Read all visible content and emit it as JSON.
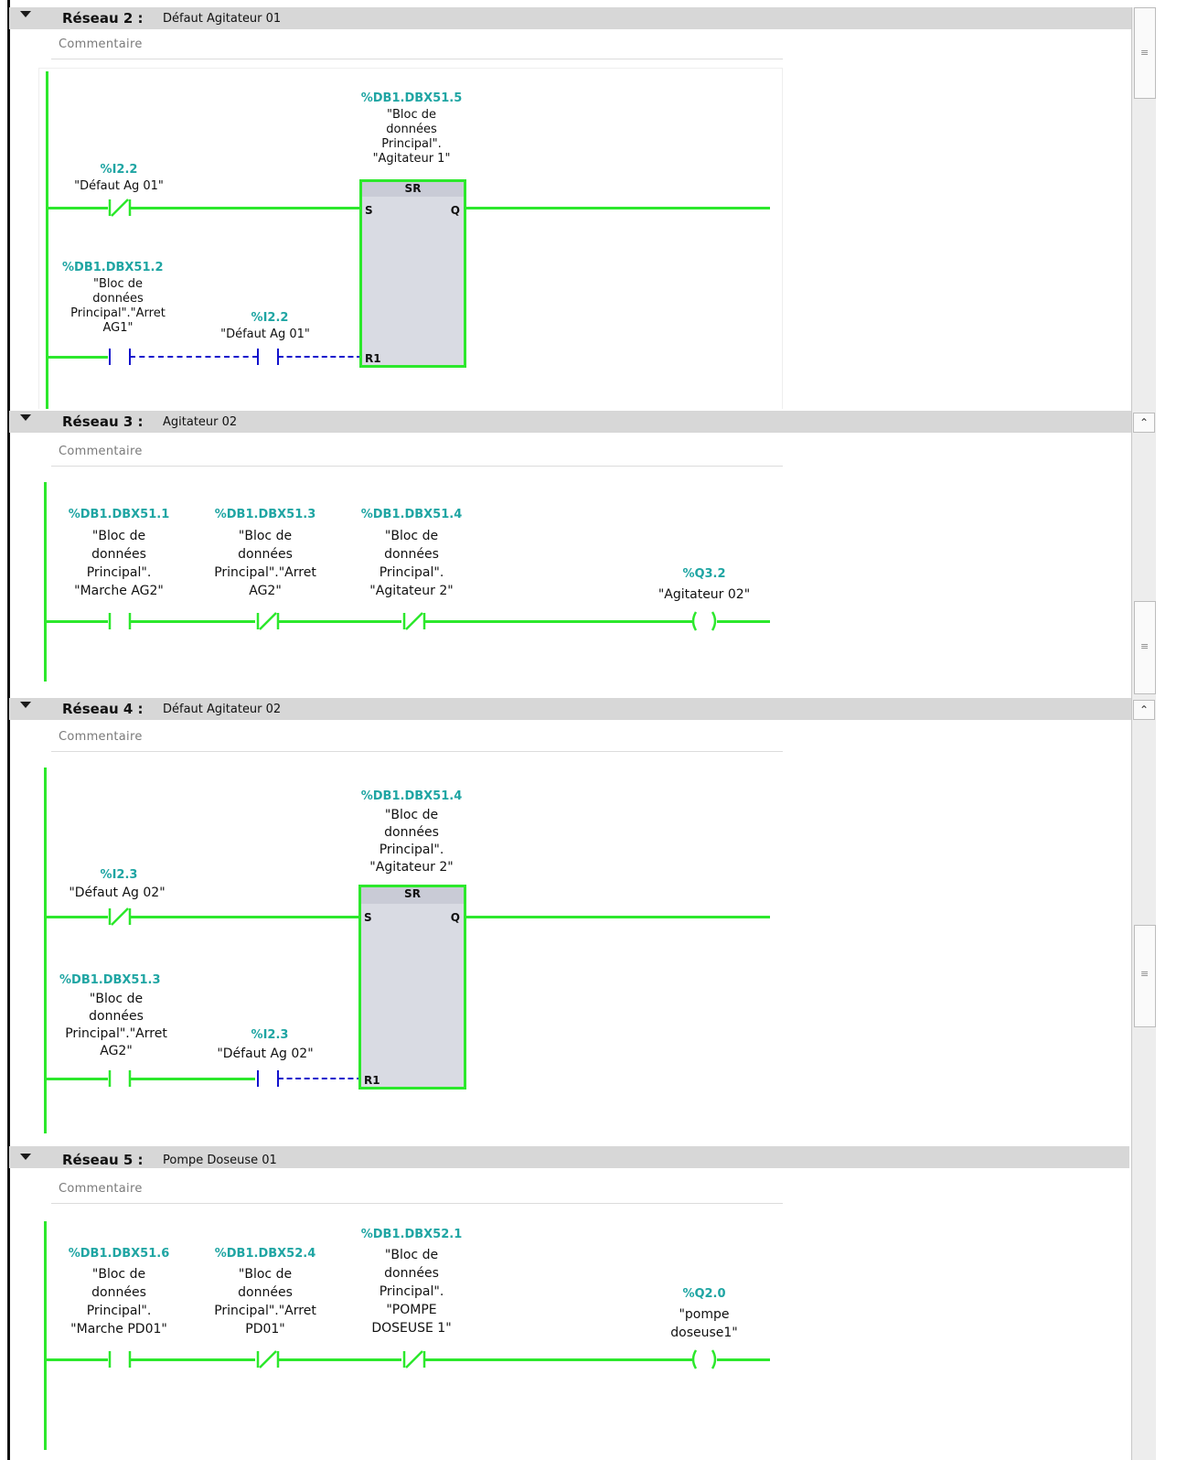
{
  "networks": [
    {
      "title": "Réseau 2 :",
      "subtitle": "Défaut Agitateur 01",
      "comment": "Commentaire",
      "sr": {
        "addr": "%DB1.DBX51.5",
        "label": "\"Bloc de\ndonnées\nPrincipal\".\n\"Agitateur 1\"",
        "title": "SR",
        "pin_s": "S",
        "pin_q": "Q",
        "pin_r": "R1"
      },
      "contacts": [
        {
          "addr": "%I2.2",
          "label": "\"Défaut Ag 01\""
        },
        {
          "addr": "%DB1.DBX51.2",
          "label": "\"Bloc de\ndonnées\nPrincipal\".\"Arret\nAG1\""
        },
        {
          "addr": "%I2.2",
          "label": "\"Défaut Ag 01\""
        }
      ]
    },
    {
      "title": "Réseau 3 :",
      "subtitle": "Agitateur 02",
      "comment": "Commentaire",
      "contacts": [
        {
          "addr": "%DB1.DBX51.1",
          "label": "\"Bloc de\ndonnées\nPrincipal\".\n\"Marche AG2\""
        },
        {
          "addr": "%DB1.DBX51.3",
          "label": "\"Bloc de\ndonnées\nPrincipal\".\"Arret\nAG2\""
        },
        {
          "addr": "%DB1.DBX51.4",
          "label": "\"Bloc de\ndonnées\nPrincipal\".\n\"Agitateur 2\""
        }
      ],
      "coil": {
        "addr": "%Q3.2",
        "label": "\"Agitateur 02\""
      }
    },
    {
      "title": "Réseau 4 :",
      "subtitle": "Défaut Agitateur 02",
      "comment": "Commentaire",
      "sr": {
        "addr": "%DB1.DBX51.4",
        "label": "\"Bloc de\ndonnées\nPrincipal\".\n\"Agitateur 2\"",
        "title": "SR",
        "pin_s": "S",
        "pin_q": "Q",
        "pin_r": "R1"
      },
      "contacts": [
        {
          "addr": "%I2.3",
          "label": "\"Défaut Ag 02\""
        },
        {
          "addr": "%DB1.DBX51.3",
          "label": "\"Bloc de\ndonnées\nPrincipal\".\"Arret\nAG2\""
        },
        {
          "addr": "%I2.3",
          "label": "\"Défaut Ag 02\""
        }
      ]
    },
    {
      "title": "Réseau 5 :",
      "subtitle": "Pompe Doseuse 01",
      "comment": "Commentaire",
      "contacts": [
        {
          "addr": "%DB1.DBX51.6",
          "label": "\"Bloc de\ndonnées\nPrincipal\".\n\"Marche PD01\""
        },
        {
          "addr": "%DB1.DBX52.4",
          "label": "\"Bloc de\ndonnées\nPrincipal\".\"Arret\nPD01\""
        },
        {
          "addr": "%DB1.DBX52.1",
          "label": "\"Bloc de\ndonnées\nPrincipal\".\n\"POMPE\nDOSEUSE 1\""
        }
      ],
      "coil": {
        "addr": "%Q2.0",
        "label": "\"pompe\ndoseuse1\""
      }
    }
  ],
  "colors": {
    "wire": "#2ce82c",
    "address": "#1fa5a3",
    "dashed": "#1111cc",
    "header": "#d7d7d7"
  },
  "icons": {
    "collapse": "triangle-down-icon",
    "scroll_thumb": "grip-icon",
    "scroll_up": "chevron-up-icon"
  }
}
